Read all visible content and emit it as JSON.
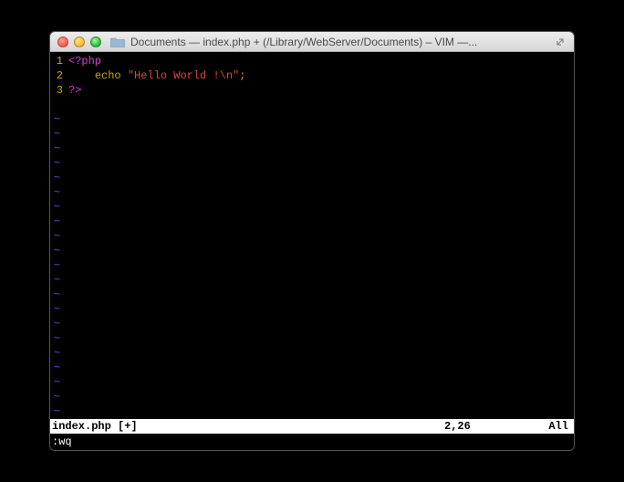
{
  "window": {
    "title": "Documents — index.php + (/Library/WebServer/Documents) – VIM —..."
  },
  "editor": {
    "lines": [
      {
        "num": "1",
        "tokens": [
          {
            "cls": "php-tag",
            "text": "<?php"
          }
        ]
      },
      {
        "num": "2",
        "tokens": [
          {
            "cls": "",
            "text": "    "
          },
          {
            "cls": "kw",
            "text": "echo "
          },
          {
            "cls": "str",
            "text": "\"Hello World !\\n\""
          },
          {
            "cls": "semi",
            "text": ";"
          }
        ]
      },
      {
        "num": "3",
        "tokens": [
          {
            "cls": "php-tag",
            "text": "?>"
          }
        ]
      }
    ],
    "tilde_count": 22
  },
  "statusbar": {
    "filename": "index.php [+]",
    "position": "2,26",
    "scroll": "All"
  },
  "command": ":wq"
}
